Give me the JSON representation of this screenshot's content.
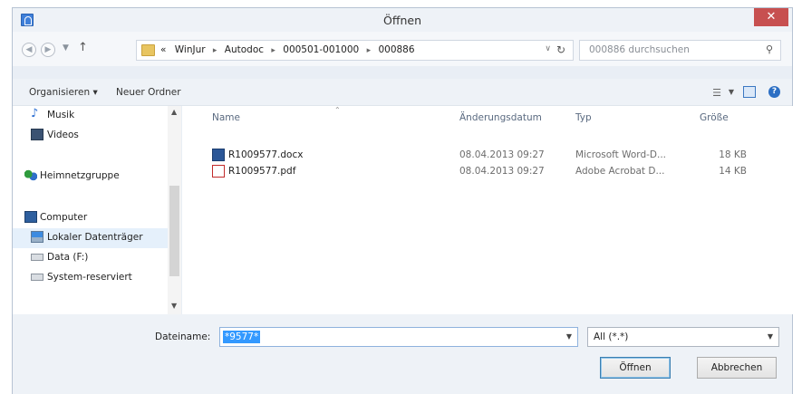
{
  "window": {
    "title": "Öffnen",
    "close_label": "✕"
  },
  "address_bar": {
    "back_icon": "back-arrow-icon",
    "forward_icon": "forward-arrow-icon",
    "breadcrumb_prefix": "«",
    "breadcrumbs": [
      "WinJur",
      "Autodoc",
      "000501-001000",
      "000886"
    ],
    "search_placeholder": "000886 durchsuchen"
  },
  "toolbar": {
    "organize_label": "Organisieren ▾",
    "new_folder_label": "Neuer Ordner"
  },
  "nav_pane": {
    "items": [
      {
        "label": "Musik",
        "icon": "music-icon"
      },
      {
        "label": "Videos",
        "icon": "video-icon"
      },
      {
        "label": "Heimnetzgruppe",
        "icon": "homegroup-icon"
      },
      {
        "label": "Computer",
        "icon": "computer-icon"
      },
      {
        "label": "Lokaler Datenträger",
        "icon": "drive-icon",
        "selected": true
      },
      {
        "label": "Data (F:)",
        "icon": "drive-icon"
      },
      {
        "label": "System-reserviert",
        "icon": "drive-icon"
      }
    ]
  },
  "file_list": {
    "columns": {
      "name": "Name",
      "date": "Änderungsdatum",
      "type": "Typ",
      "size": "Größe"
    },
    "rows": [
      {
        "name": "R1009577.docx",
        "date": "08.04.2013 09:27",
        "type": "Microsoft Word-D...",
        "size": "18 KB",
        "icon": "word-document-icon"
      },
      {
        "name": "R1009577.pdf",
        "date": "08.04.2013 09:27",
        "type": "Adobe Acrobat D...",
        "size": "14 KB",
        "icon": "pdf-document-icon"
      }
    ]
  },
  "footer": {
    "filename_label": "Dateiname:",
    "filename_value": "*9577*",
    "filter_value": "All (*.*)",
    "open_label": "Öffnen",
    "cancel_label": "Abbrechen"
  },
  "colors": {
    "close_button": "#c75050",
    "selection": "#3399ff",
    "window_frame": "#e9eef5"
  }
}
